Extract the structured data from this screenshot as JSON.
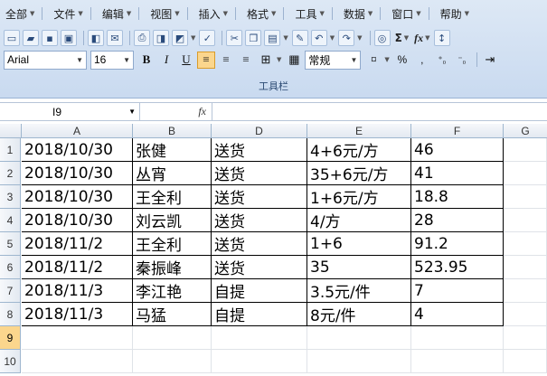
{
  "menubar": {
    "items": [
      "全部",
      "文件",
      "编辑",
      "视图",
      "插入",
      "格式",
      "工具",
      "数据",
      "窗口",
      "帮助"
    ]
  },
  "toolbar": {
    "font_name": "Arial",
    "font_size": "16",
    "bold": "B",
    "italic": "I",
    "underline": "U",
    "number_format": "常规",
    "percent": "%",
    "comma": ",",
    "sigma": "Σ",
    "fx": "fx",
    "caption": "工具栏"
  },
  "formula_bar": {
    "cell_reference": "I9",
    "fx_label": "fx",
    "content": ""
  },
  "sheet": {
    "columns": [
      "A",
      "B",
      "D",
      "E",
      "F",
      "G"
    ],
    "rows": [
      "1",
      "2",
      "3",
      "4",
      "5",
      "6",
      "7",
      "8",
      "9",
      "10"
    ],
    "selected_row": "9",
    "data": [
      [
        "2018/10/30",
        "张健",
        "送货",
        "4+6元/方",
        "46"
      ],
      [
        "2018/10/30",
        "丛宵",
        "送货",
        "35+6元/方",
        "41"
      ],
      [
        "2018/10/30",
        "王全利",
        "送货",
        "1+6元/方",
        "18.8"
      ],
      [
        "2018/10/30",
        "刘云凯",
        "送货",
        "4/方",
        "28"
      ],
      [
        "2018/11/2",
        "王全利",
        "送货",
        "1+6",
        "91.2"
      ],
      [
        "2018/11/2",
        "秦振峰",
        "送货",
        "35",
        "523.95"
      ],
      [
        "2018/11/3",
        "李江艳",
        "自提",
        "3.5元/件",
        "7"
      ],
      [
        "2018/11/3",
        "马猛",
        "自提",
        "8元/件",
        "4"
      ]
    ]
  }
}
